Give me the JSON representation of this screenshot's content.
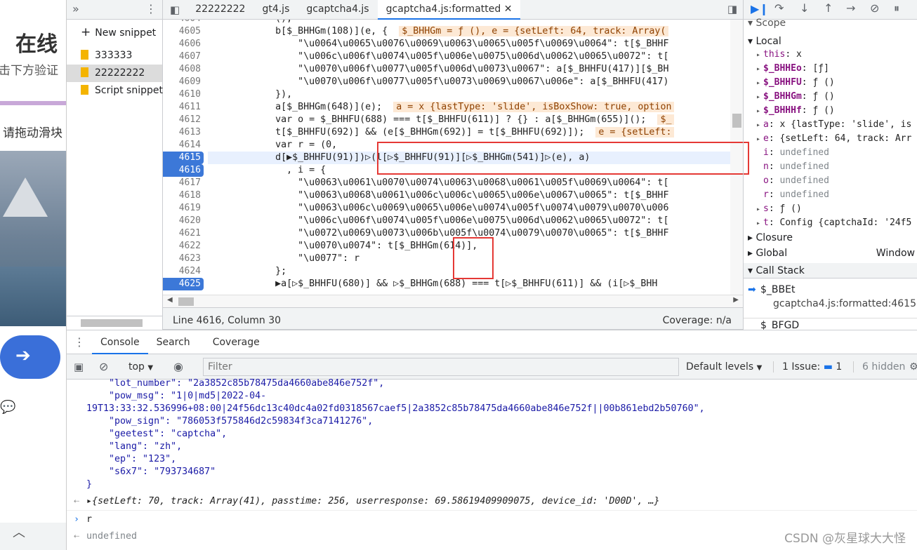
{
  "page": {
    "title": "在线",
    "subtitle": "击下方验证",
    "drag_hint": "请拖动滑块"
  },
  "snippets": {
    "new_snippet": "New snippet",
    "items": [
      "333333",
      "22222222",
      "Script snippet"
    ]
  },
  "editor": {
    "tabs": [
      "22222222",
      "gt4.js",
      "gcaptcha4.js",
      "gcaptcha4.js:formatted"
    ],
    "status_line": "Line 4616, Column 30",
    "coverage": "Coverage: n/a",
    "lines": [
      {
        "n": "4604",
        "text": "            (),"
      },
      {
        "n": "4605",
        "text": "            b[$_BHHGm(108)](e, {  ",
        "inline": "$_BHHGm = ƒ (), e = {setLeft: 64, track: Array("
      },
      {
        "n": "4606",
        "text": "                \"\\u0064\\u0065\\u0076\\u0069\\u0063\\u0065\\u005f\\u0069\\u0064\": t[$_BHHF"
      },
      {
        "n": "4607",
        "text": "                \"\\u006c\\u006f\\u0074\\u005f\\u006e\\u0075\\u006d\\u0062\\u0065\\u0072\": t["
      },
      {
        "n": "4608",
        "text": "                \"\\u0070\\u006f\\u0077\\u005f\\u006d\\u0073\\u0067\": a[$_BHHFU(417)][$_BH"
      },
      {
        "n": "4609",
        "text": "                \"\\u0070\\u006f\\u0077\\u005f\\u0073\\u0069\\u0067\\u006e\": a[$_BHHFU(417)"
      },
      {
        "n": "4610",
        "text": "            }),"
      },
      {
        "n": "4611",
        "text": "            a[$_BHHGm(648)](e);  ",
        "inline": "a = x {lastType: 'slide', isBoxShow: true, option"
      },
      {
        "n": "4612",
        "text": "            var o = $_BHHFU(688) === t[$_BHHFU(611)] ? {} : a[$_BHHGm(655)]();  ",
        "inline": "$_"
      },
      {
        "n": "4613",
        "text": "            t[$_BHHFU(692)] && (e[$_BHHGm(692)] = t[$_BHHFU(692)]);  ",
        "inline": "e = {setLeft:"
      },
      {
        "n": "4614",
        "text": "            var r = (0,"
      },
      {
        "n": "4615",
        "text": "            d[▶$_BHHFU(91)])▷(l[▷$_BHHFU(91)][▷$_BHHGm(541)]▷(e), a)",
        "bp": true,
        "hl": true
      },
      {
        "n": "4616",
        "text": "              , i = {",
        "bp": true
      },
      {
        "n": "4617",
        "text": "                \"\\u0063\\u0061\\u0070\\u0074\\u0063\\u0068\\u0061\\u005f\\u0069\\u0064\": t["
      },
      {
        "n": "4618",
        "text": "                \"\\u0063\\u0068\\u0061\\u006c\\u006c\\u0065\\u006e\\u0067\\u0065\": t[$_BHHF"
      },
      {
        "n": "4619",
        "text": "                \"\\u0063\\u006c\\u0069\\u0065\\u006e\\u0074\\u005f\\u0074\\u0079\\u0070\\u006"
      },
      {
        "n": "4620",
        "text": "                \"\\u006c\\u006f\\u0074\\u005f\\u006e\\u0075\\u006d\\u0062\\u0065\\u0072\": t["
      },
      {
        "n": "4621",
        "text": "                \"\\u0072\\u0069\\u0073\\u006b\\u005f\\u0074\\u0079\\u0070\\u0065\": t[$_BHHF"
      },
      {
        "n": "4622",
        "text": "                \"\\u0070\\u0074\": t[$_BHHGm(614)],"
      },
      {
        "n": "4623",
        "text": "                \"\\u0077\": r"
      },
      {
        "n": "4624",
        "text": "            };"
      },
      {
        "n": "4625",
        "text": "            ▶a[▷$_BHHFU(680)] && ▷$_BHHGm(688) === t[▷$_BHHFU(611)] && (i[▷$_BHH",
        "bp": true
      }
    ]
  },
  "scope": {
    "header": "Scope",
    "local": "Local",
    "items": [
      {
        "name": "this",
        "value": "x"
      },
      {
        "name": "$_BHHEo",
        "value": "[ƒ]",
        "bold": true
      },
      {
        "name": "$_BHHFU",
        "value": "ƒ ()",
        "bold": true
      },
      {
        "name": "$_BHHGm",
        "value": "ƒ ()",
        "bold": true
      },
      {
        "name": "$_BHHHf",
        "value": "ƒ ()",
        "bold": true
      },
      {
        "name": "a",
        "value": "x {lastType: 'slide', is"
      },
      {
        "name": "e",
        "value": "{setLeft: 64, track: Arr"
      },
      {
        "name": "i",
        "value": "undefined"
      },
      {
        "name": "n",
        "value": "undefined"
      },
      {
        "name": "o",
        "value": "undefined"
      },
      {
        "name": "r",
        "value": "undefined"
      },
      {
        "name": "s",
        "value": "ƒ ()"
      },
      {
        "name": "t",
        "value": "Config {captchaId: '24f5"
      }
    ],
    "closure": "Closure",
    "global": "Global",
    "global_value": "Window",
    "call_stack": "Call Stack",
    "frames": [
      {
        "name": "$_BBEt",
        "loc": "gcaptcha4.js:formatted:4615"
      },
      {
        "name": "$_BFGD",
        "loc": ""
      }
    ]
  },
  "console": {
    "tabs": [
      "Console",
      "Search",
      "Coverage"
    ],
    "context": "top",
    "filter_placeholder": "Filter",
    "levels": "Default levels",
    "issues": "1 Issue:",
    "issues_count": "1",
    "hidden": "6 hidden",
    "lines": [
      "    \"lot_number\": \"2a3852c85b78475da4660abe846e752f\",",
      "    \"pow_msg\": \"1|0|md5|2022-04-",
      "19T13:33:32.536996+08:00|24f56dc13c40dc4a02fd0318567caef5|2a3852c85b78475da4660abe846e752f||00b861ebd2b50760\",",
      "    \"pow_sign\": \"786053f575846d2c59834f3ca7141276\",",
      "    \"geetest\": \"captcha\",",
      "    \"lang\": \"zh\",",
      "    \"ep\": \"123\",",
      "    \"s6x7\": \"793734687\"",
      "}"
    ],
    "result_obj": "{setLeft: 70, track: Array(41), passtime: 256, userresponse: 69.58619409909075, device_id: 'D00D', …}",
    "input": "r",
    "output": "undefined"
  },
  "watermark": "CSDN @灰星球大大怪"
}
